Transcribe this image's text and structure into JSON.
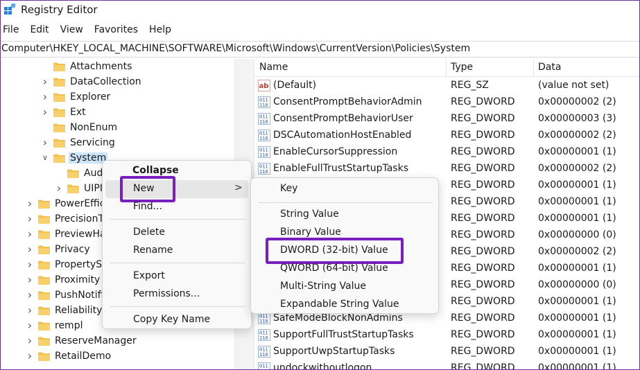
{
  "window": {
    "title": "Registry Editor"
  },
  "menubar": [
    "File",
    "Edit",
    "View",
    "Favorites",
    "Help"
  ],
  "address": "Computer\\HKEY_LOCAL_MACHINE\\SOFTWARE\\Microsoft\\Windows\\CurrentVersion\\Policies\\System",
  "tree": {
    "items": [
      {
        "label": "Attachments",
        "chevron": "",
        "level": 2
      },
      {
        "label": "DataCollection",
        "chevron": ">",
        "level": 2
      },
      {
        "label": "Explorer",
        "chevron": ">",
        "level": 2
      },
      {
        "label": "Ext",
        "chevron": ">",
        "level": 2
      },
      {
        "label": "NonEnum",
        "chevron": "",
        "level": 2
      },
      {
        "label": "Servicing",
        "chevron": ">",
        "level": 2
      },
      {
        "label": "System",
        "chevron": "v",
        "level": 2,
        "selected": true
      },
      {
        "label": "Aud",
        "chevron": "",
        "level": 3
      },
      {
        "label": "UIPI",
        "chevron": ">",
        "level": 3
      },
      {
        "label": "PowerEffic",
        "chevron": ">",
        "level": 1
      },
      {
        "label": "PrecisionT",
        "chevron": ">",
        "level": 1
      },
      {
        "label": "PreviewHa",
        "chevron": ">",
        "level": 1
      },
      {
        "label": "Privacy",
        "chevron": ">",
        "level": 1
      },
      {
        "label": "PropertySy",
        "chevron": ">",
        "level": 1
      },
      {
        "label": "Proximity",
        "chevron": ">",
        "level": 1
      },
      {
        "label": "PushNotifi",
        "chevron": ">",
        "level": 1
      },
      {
        "label": "Reliability",
        "chevron": ">",
        "level": 1
      },
      {
        "label": "rempl",
        "chevron": ">",
        "level": 1
      },
      {
        "label": "ReserveManager",
        "chevron": ">",
        "level": 1
      },
      {
        "label": "RetailDemo",
        "chevron": ">",
        "level": 1
      }
    ]
  },
  "list": {
    "columns": [
      "Name",
      "Type",
      "Data"
    ],
    "rows": [
      {
        "name": "(Default)",
        "type": "REG_SZ",
        "data": "(value not set)",
        "icon": "string"
      },
      {
        "name": "ConsentPromptBehaviorAdmin",
        "type": "REG_DWORD",
        "data": "0x00000002 (2)",
        "icon": "binary"
      },
      {
        "name": "ConsentPromptBehaviorUser",
        "type": "REG_DWORD",
        "data": "0x00000003 (3)",
        "icon": "binary"
      },
      {
        "name": "DSCAutomationHostEnabled",
        "type": "REG_DWORD",
        "data": "0x00000002 (2)",
        "icon": "binary"
      },
      {
        "name": "EnableCursorSuppression",
        "type": "REG_DWORD",
        "data": "0x00000001 (1)",
        "icon": "binary"
      },
      {
        "name": "EnableFullTrustStartupTasks",
        "type": "REG_DWORD",
        "data": "0x00000002 (2)",
        "icon": "binary"
      },
      {
        "name": "",
        "type": "REG_DWORD",
        "data": "0x00000001 (1)",
        "icon": ""
      },
      {
        "name": "",
        "type": "REG_DWORD",
        "data": "0x00000001 (1)",
        "icon": ""
      },
      {
        "name": "",
        "type": "REG_DWORD",
        "data": "0x00000001 (1)",
        "icon": ""
      },
      {
        "name": "",
        "type": "REG_DWORD",
        "data": "0x00000000 (0)",
        "icon": ""
      },
      {
        "name": "",
        "type": "REG_DWORD",
        "data": "0x00000002 (2)",
        "icon": ""
      },
      {
        "name": "",
        "type": "REG_DWORD",
        "data": "0x00000001 (1)",
        "icon": ""
      },
      {
        "name": "",
        "type": "REG_DWORD",
        "data": "0x00000000 (0)",
        "icon": ""
      },
      {
        "name": "",
        "type": "REG_DWORD",
        "data": "0x00000001 (1)",
        "icon": ""
      },
      {
        "name": "SafeModeBlockNonAdmins",
        "type": "REG_DWORD",
        "data": "0x00000001 (1)",
        "icon": "binary"
      },
      {
        "name": "SupportFullTrustStartupTasks",
        "type": "REG_DWORD",
        "data": "0x00000001 (1)",
        "icon": "binary"
      },
      {
        "name": "SupportUwpStartupTasks",
        "type": "REG_DWORD",
        "data": "0x00000001 (1)",
        "icon": "binary"
      },
      {
        "name": "undockwithoutlogon",
        "type": "REG_DWORD",
        "data": "0x00000001 (1)",
        "icon": "binary"
      }
    ]
  },
  "context_menu": {
    "collapse": "Collapse",
    "new": "New",
    "find": "Find...",
    "delete": "Delete",
    "rename": "Rename",
    "export": "Export",
    "permissions": "Permissions...",
    "copy_key_name": "Copy Key Name",
    "submenu_arrow": ">"
  },
  "new_submenu": {
    "key": "Key",
    "string_value": "String Value",
    "binary_value": "Binary Value",
    "dword_value": "DWORD (32-bit) Value",
    "qword_value": "QWORD (64-bit) Value",
    "multi_string_value": "Multi-String Value",
    "expandable_string_value": "Expandable String Value"
  },
  "colors": {
    "highlight_box": "#7a1fbf",
    "folder": "#f2c14e",
    "selection": "#cce4f7",
    "binary_icon": "#2b5fad",
    "string_icon": "#c0392b"
  }
}
